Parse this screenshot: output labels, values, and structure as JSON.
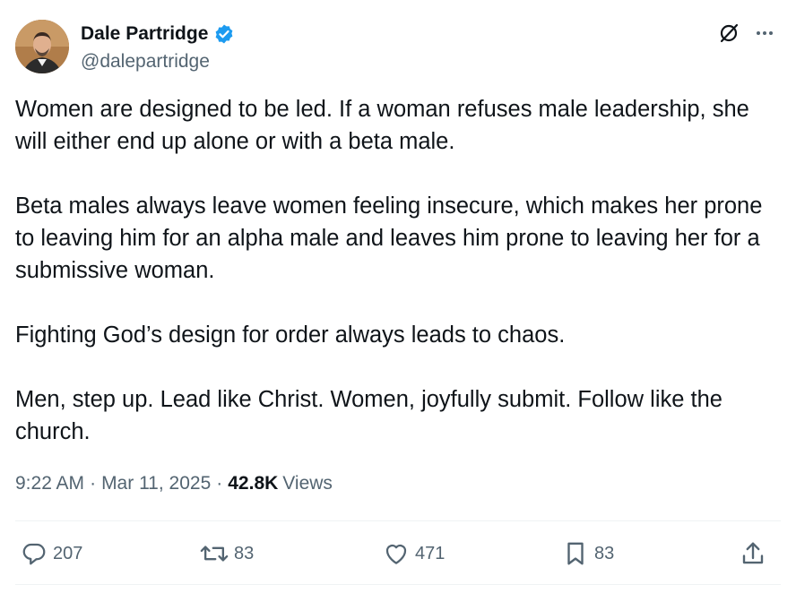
{
  "author": {
    "name": "Dale Partridge",
    "handle": "@dalepartridge",
    "verified": true
  },
  "icons": {
    "verified": "verified-badge-icon",
    "grok": "grok-icon",
    "more": "more-icon",
    "reply": "reply-icon",
    "retweet": "retweet-icon",
    "like": "like-icon",
    "bookmark": "bookmark-icon",
    "share": "share-icon"
  },
  "tweet": {
    "paragraphs": [
      "Women are designed to be led. If a woman refuses male leadership, she will either end up alone or with a beta male.",
      "Beta males always leave women feeling insecure, which makes her prone to leaving him for an alpha male and leaves him prone to leaving her for a submissive woman.",
      "Fighting God’s design for order always leads to chaos.",
      "Men, step up. Lead like Christ. Women, joyfully submit. Follow like the church."
    ]
  },
  "meta": {
    "time": "9:22 AM",
    "date": "Mar 11, 2025",
    "views_count": "42.8K",
    "views_label": "Views"
  },
  "actions": {
    "replies": "207",
    "retweets": "83",
    "likes": "471",
    "bookmarks": "83"
  },
  "colors": {
    "text": "#0f1419",
    "secondary": "#536471",
    "verified": "#1d9bf0",
    "divider": "#eff3f4"
  }
}
